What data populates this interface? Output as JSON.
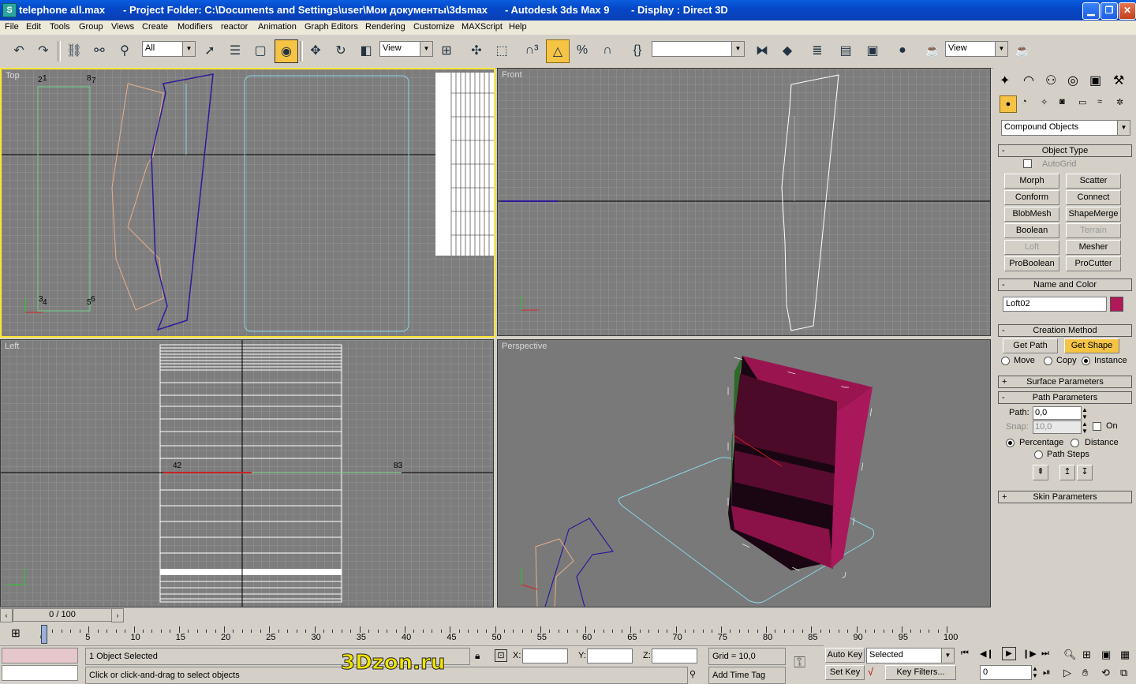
{
  "title": {
    "file": "telephone all.max",
    "project": "- Project Folder: C:\\Documents and Settings\\user\\Мои документы\\3dsmax",
    "app": "- Autodesk 3ds Max 9",
    "display": "- Display : Direct 3D"
  },
  "menu": [
    "File",
    "Edit",
    "Tools",
    "Group",
    "Views",
    "Create",
    "Modifiers",
    "reactor",
    "Animation",
    "Graph Editors",
    "Rendering",
    "Customize",
    "MAXScript",
    "Help"
  ],
  "toolbar": {
    "selection_filter": "All",
    "ref_coord": "View",
    "ref_coord_right": "View",
    "named_selection": ""
  },
  "viewports": {
    "top": "Top",
    "front": "Front",
    "left": "Left",
    "perspective": "Perspective"
  },
  "top_labels": [
    "2",
    "1",
    "8",
    "7",
    "3",
    "4",
    "5",
    "6"
  ],
  "left_labels": {
    "a": "42",
    "b": "83"
  },
  "panel": {
    "category": "Compound Objects",
    "object_type": {
      "title": "Object Type",
      "autogrid": "AutoGrid",
      "buttons": [
        "Morph",
        "Scatter",
        "Conform",
        "Connect",
        "BlobMesh",
        "ShapeMerge",
        "Boolean",
        "Terrain",
        "Loft",
        "Mesher",
        "ProBoolean",
        "ProCutter"
      ]
    },
    "name_color": {
      "title": "Name and Color",
      "name": "Loft02",
      "color": "#b0185a"
    },
    "creation_method": {
      "title": "Creation Method",
      "get_path": "Get Path",
      "get_shape": "Get Shape",
      "move": "Move",
      "copy": "Copy",
      "instance": "Instance"
    },
    "surface_parameters": "Surface Parameters",
    "path_parameters": {
      "title": "Path Parameters",
      "path_label": "Path:",
      "path_value": "0,0",
      "snap_label": "Snap:",
      "snap_value": "10,0",
      "on": "On",
      "percentage": "Percentage",
      "distance": "Distance",
      "path_steps": "Path Steps"
    },
    "skin_parameters": "Skin Parameters"
  },
  "timeline": {
    "slider": "0 / 100",
    "ticks": [
      "0",
      "5",
      "10",
      "15",
      "20",
      "25",
      "30",
      "35",
      "40",
      "45",
      "50",
      "55",
      "60",
      "65",
      "70",
      "75",
      "80",
      "85",
      "90",
      "95",
      "100"
    ]
  },
  "status": {
    "selected": "1 Object Selected",
    "prompt": "Click or click-and-drag to select objects",
    "x": "X:",
    "y": "Y:",
    "z": "Z:",
    "grid": "Grid = 10,0",
    "add_time_tag": "Add Time Tag",
    "auto_key": "Auto Key",
    "set_key": "Set Key",
    "key_mode": "Selected",
    "key_filters": "Key Filters...",
    "frame": "0"
  },
  "watermark": "3Dzon.ru"
}
